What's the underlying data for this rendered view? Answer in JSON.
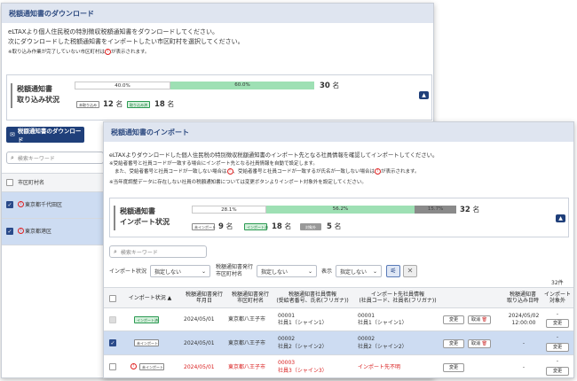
{
  "w1": {
    "header": "税額通知書のダウンロード",
    "desc1": "eLTAXより個人住民税の特別徴収税額通知書をダウンロードしてください。",
    "desc2": "次にダウンロードした税額通知書をインポートしたい市区町村を選択してください。",
    "note_prefix": "※取り込み作業が完了していない市区町村は",
    "note_icon": "!",
    "note_suffix": "が表示されます。",
    "status_title1": "税額通知書",
    "status_title2": "取り込み状況",
    "bar": [
      {
        "label": "40.0%",
        "fraction": 0.4,
        "color": "#ffffff"
      },
      {
        "label": "60.0%",
        "fraction": 0.6,
        "color": "#9ee0b4"
      }
    ],
    "total": "30",
    "unit": "名",
    "counts": [
      {
        "tag": "未取り込み",
        "value": "12",
        "unit": "名"
      },
      {
        "tag": "取り込み済",
        "value": "18",
        "unit": "名"
      }
    ],
    "download_button": "税額通知書のダウンロード",
    "search_placeholder": "検索キーワード",
    "col_header": "市区町村名",
    "rows": [
      {
        "name": "東京都千代田区",
        "checked": true
      },
      {
        "name": "東京都港区",
        "checked": true
      }
    ]
  },
  "w2": {
    "header": "税額通知書のインポート",
    "desc": "eLTAXよりダウンロードした個人住民税の特別徴収税額通知書のインポート先となる社員情報を確認してインポートしてください。",
    "note1": "※受給者番号と社員コードが一致する場合にインポート先となる社員情報を自動で設定します。",
    "note2_a": "また、受給者番号と社員コードが一致しない場合は",
    "note2_b": "、受給者番号と社員コードが一致するが氏名が一致しない場合は",
    "note2_c": "が表示されます。",
    "note3": "※当年度調整データに存在しない社員の税額通知書については変更ボタンよりインポート対象外を設定してください。",
    "status_title1": "税額通知書",
    "status_title2": "インポート状況",
    "bar": [
      {
        "label": "28.1%",
        "fraction": 0.281,
        "color": "#ffffff"
      },
      {
        "label": "56.2%",
        "fraction": 0.562,
        "color": "#9ee0b4"
      },
      {
        "label": "15.7%",
        "fraction": 0.157,
        "color": "#8a8a8a"
      }
    ],
    "total": "32",
    "unit": "名",
    "counts": [
      {
        "tag": "未インポート",
        "value": "9",
        "unit": "名"
      },
      {
        "tag": "インポート済",
        "value": "18",
        "unit": "名"
      },
      {
        "tag": "対象外",
        "value": "5",
        "unit": "名"
      }
    ],
    "search_placeholder": "検索キーワード",
    "filters": {
      "import_status_label": "インポート状況",
      "import_status_value": "指定しない",
      "issuer_label1": "税額通知書発行",
      "issuer_label2": "市区町村名",
      "issuer_value": "指定しない",
      "display_label": "表示",
      "display_value": "指定しない"
    },
    "result_count": "32件",
    "columns": {
      "status": "インポート状況",
      "issue_ym1": "税額通知書発行",
      "issue_ym2": "年月日",
      "city1": "税額通知書発行",
      "city2": "市区町村名",
      "emp1": "税額通知書社員情報",
      "emp2": "(受給者番号、氏名(フリガナ))",
      "target1": "インポート先社員情報",
      "target2": "(社員コード、社員名(フリガナ))",
      "date1": "税額通知書",
      "date2": "取り込み日時",
      "excl1": "インポート",
      "excl2": "対象外"
    },
    "rows": [
      {
        "tag": "インポート済",
        "date": "2024/05/01",
        "city": "東京都八王子市",
        "emp_no": "00001",
        "emp_name": "社員1（シャイン1）",
        "tgt_no": "00001",
        "tgt_name": "社員1（シャイン1）",
        "change": "変更",
        "cancel": "取消",
        "imported_at1": "2024/05/02",
        "imported_at2": "12:00:00",
        "excl": "-",
        "excl_btn": "変更"
      },
      {
        "tag": "未インポート",
        "date": "2024/05/01",
        "city": "東京都八王子市",
        "emp_no": "00002",
        "emp_name": "社員2（シャイン2）",
        "tgt_no": "00002",
        "tgt_name": "社員2（シャイン2）",
        "change": "変更",
        "cancel": "取消",
        "imported_at1": "-",
        "imported_at2": "",
        "excl": "-",
        "excl_btn": "変更"
      },
      {
        "tag": "未インポート",
        "date": "2024/05/01",
        "city": "東京都八王子市",
        "emp_no": "00003",
        "emp_name": "社員3（シャイン3）",
        "tgt_no": "インポート先不明",
        "tgt_name": "",
        "change": "変更",
        "cancel": "",
        "imported_at1": "-",
        "imported_at2": "",
        "excl": "-",
        "excl_btn": "変更"
      }
    ]
  }
}
